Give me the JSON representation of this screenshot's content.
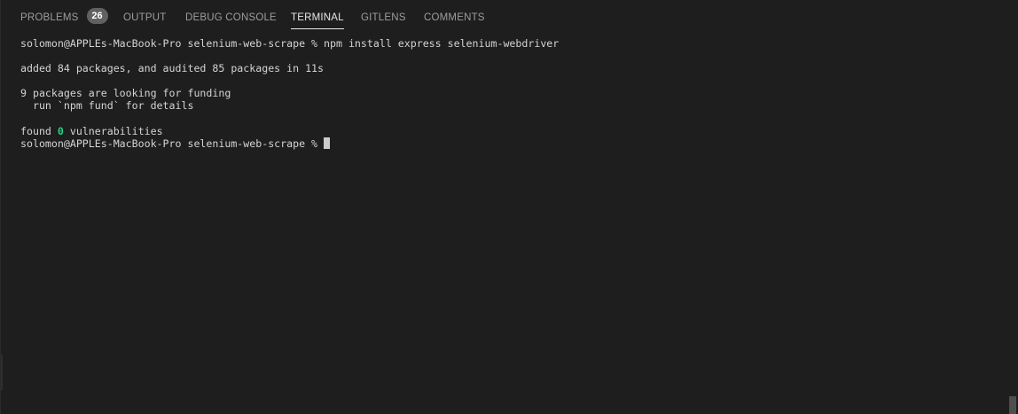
{
  "tabs": [
    {
      "label": "PROBLEMS",
      "badge": "26",
      "active": false
    },
    {
      "label": "OUTPUT",
      "active": false
    },
    {
      "label": "DEBUG CONSOLE",
      "active": false
    },
    {
      "label": "TERMINAL",
      "active": true
    },
    {
      "label": "GITLENS",
      "active": false
    },
    {
      "label": "COMMENTS",
      "active": false
    }
  ],
  "terminal": {
    "line1": "solomon@APPLEs-MacBook-Pro selenium-web-scrape % npm install express selenium-webdriver",
    "line2": "added 84 packages, and audited 85 packages in 11s",
    "line3": "9 packages are looking for funding",
    "line4": "  run `npm fund` for details",
    "line5_prefix": "found ",
    "line5_count": "0",
    "line5_suffix": " vulnerabilities",
    "prompt": "solomon@APPLEs-MacBook-Pro selenium-web-scrape % "
  },
  "colors": {
    "background": "#1e1e1e",
    "text": "#d4d4d4",
    "success": "#23d18b",
    "badge": "#616161"
  }
}
